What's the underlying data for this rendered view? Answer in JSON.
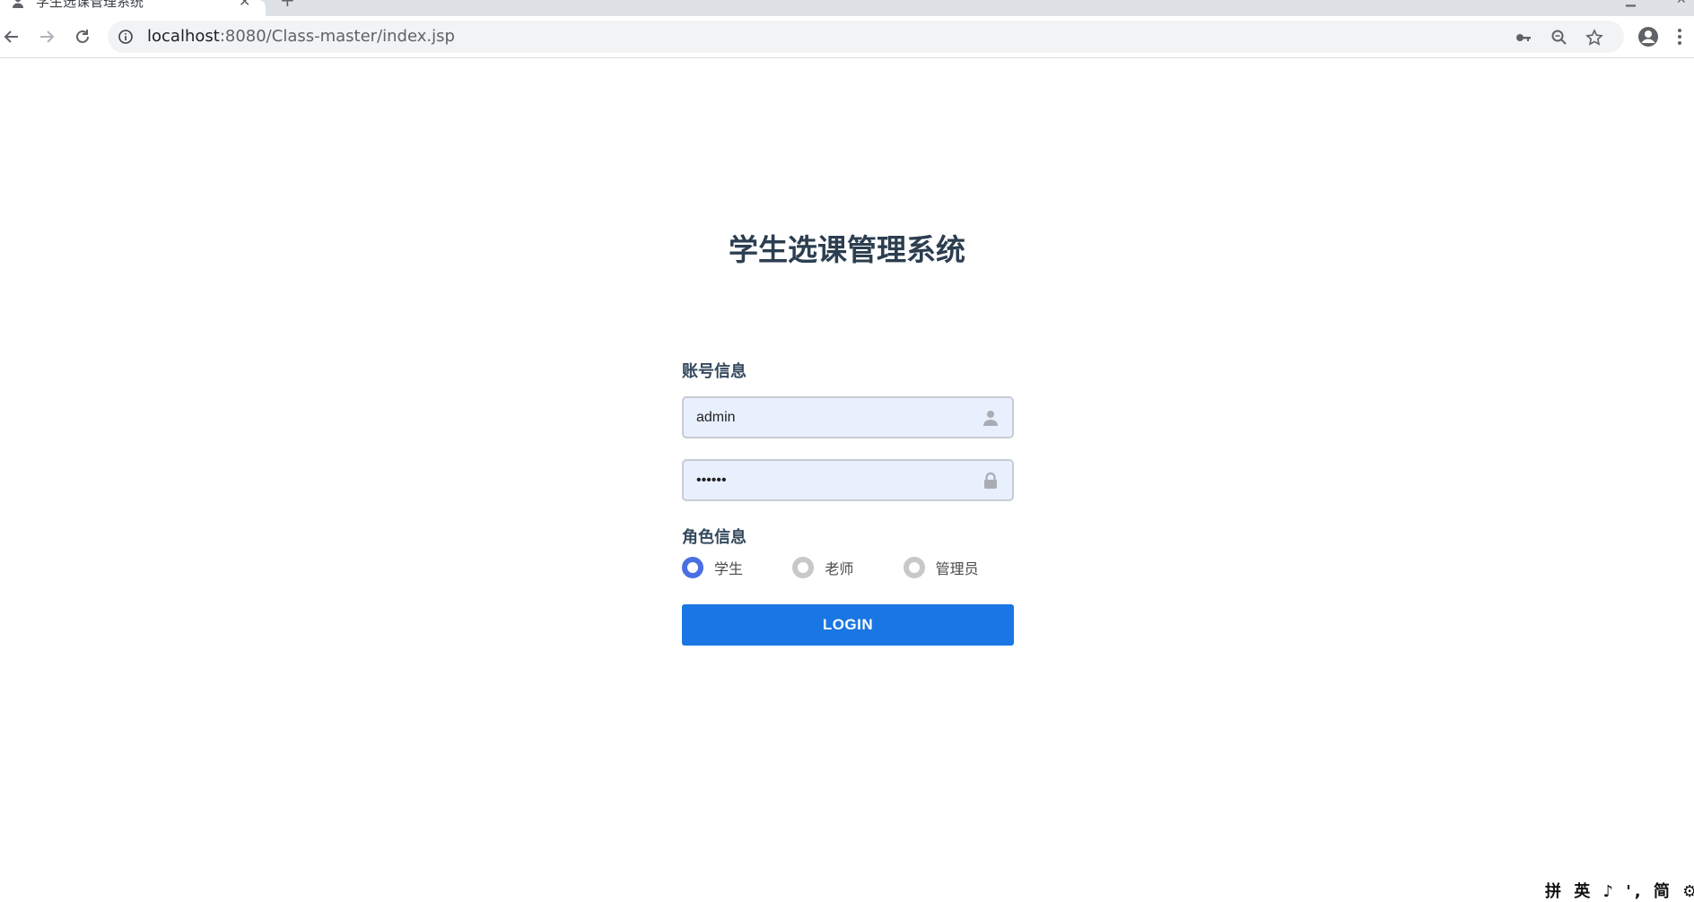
{
  "browser": {
    "tab_title": "学生选课管理系统",
    "url_host": "localhost",
    "url_path": ":8080/Class-master/index.jsp"
  },
  "page": {
    "title": "学生选课管理系统",
    "account_section_label": "账号信息",
    "username_value": "admin",
    "password_value": "••••••",
    "role_section_label": "角色信息",
    "roles": [
      {
        "label": "学生",
        "checked": true
      },
      {
        "label": "老师",
        "checked": false
      },
      {
        "label": "管理员",
        "checked": false
      }
    ],
    "login_label": "LOGIN"
  },
  "ime_bar": {
    "text": "拼 英 ♪ ', 简 ⚙"
  },
  "colors": {
    "title": "#2c3e50",
    "button": "#1976e3",
    "radio_checked": "#4a6fe3",
    "input_bg": "#e8f0fe"
  }
}
